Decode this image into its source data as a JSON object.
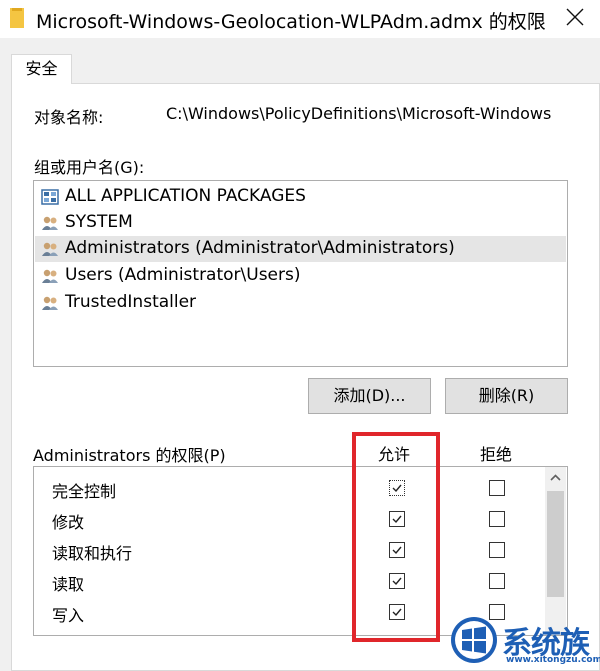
{
  "window": {
    "title": "Microsoft-Windows-Geolocation-WLPAdm.admx 的权限",
    "tab": "安全"
  },
  "object": {
    "label": "对象名称:",
    "value": "C:\\Windows\\PolicyDefinitions\\Microsoft-Windows"
  },
  "groups": {
    "label": "组或用户名(G):",
    "items": [
      {
        "name": "ALL APPLICATION PACKAGES",
        "icon": "app-packages-icon",
        "selected": false
      },
      {
        "name": "SYSTEM",
        "icon": "users-icon",
        "selected": false
      },
      {
        "name": "Administrators (Administrator\\Administrators)",
        "icon": "users-icon",
        "selected": true
      },
      {
        "name": "Users (Administrator\\Users)",
        "icon": "users-icon",
        "selected": false
      },
      {
        "name": "TrustedInstaller",
        "icon": "users-icon",
        "selected": false
      }
    ],
    "add_button": "添加(D)...",
    "remove_button": "删除(R)"
  },
  "permissions": {
    "label": "Administrators 的权限(P)",
    "allow_header": "允许",
    "deny_header": "拒绝",
    "rows": [
      {
        "name": "完全控制",
        "allow": true,
        "deny": false
      },
      {
        "name": "修改",
        "allow": true,
        "deny": false
      },
      {
        "name": "读取和执行",
        "allow": true,
        "deny": false
      },
      {
        "name": "读取",
        "allow": true,
        "deny": false
      },
      {
        "name": "写入",
        "allow": true,
        "deny": false
      }
    ]
  },
  "watermark": {
    "text": "系统族",
    "url": "www.xitongzu.com"
  },
  "colors": {
    "highlight": "#e0262b",
    "selected_row": "#e5e5e5",
    "watermark": "#1e5fb5"
  }
}
